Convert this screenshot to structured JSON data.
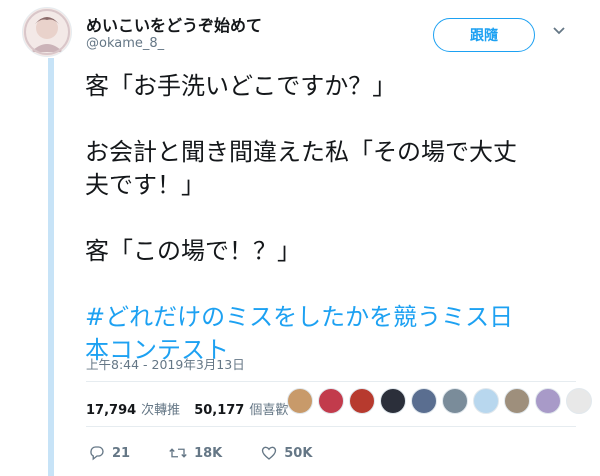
{
  "user": {
    "display_name": "めいこいをどうぞ始めて",
    "handle": "@okame_8_"
  },
  "follow_label": "跟隨",
  "tweet": {
    "lines": [
      "客「お手洗いどこですか？」",
      "",
      "お会計と聞き間違えた私「その場で大丈",
      "夫です！」",
      "",
      "客「この場で！？」",
      ""
    ],
    "hashtag_lines": [
      "#どれだけのミスをしたかを競うミス日",
      "本コンテスト"
    ]
  },
  "timestamp": "上午8:44 - 2019年3月13日",
  "stats": {
    "retweets_count": "17,794",
    "retweets_label": "次轉推",
    "likes_count": "50,177",
    "likes_label": "個喜歡"
  },
  "liker_colors": [
    "#c89a6a",
    "#c23b4c",
    "#b73a2e",
    "#2b2f3a",
    "#5a6e90",
    "#7a8c9a",
    "#b8d7ee",
    "#9e8f7c",
    "#a89ac8",
    "#e8e8e8"
  ],
  "actions": {
    "reply_count": "21",
    "retweet_count": "18K",
    "like_count": "50K"
  },
  "colors": {
    "accent": "#1da1f2",
    "text": "#14171a",
    "muted": "#657786"
  }
}
